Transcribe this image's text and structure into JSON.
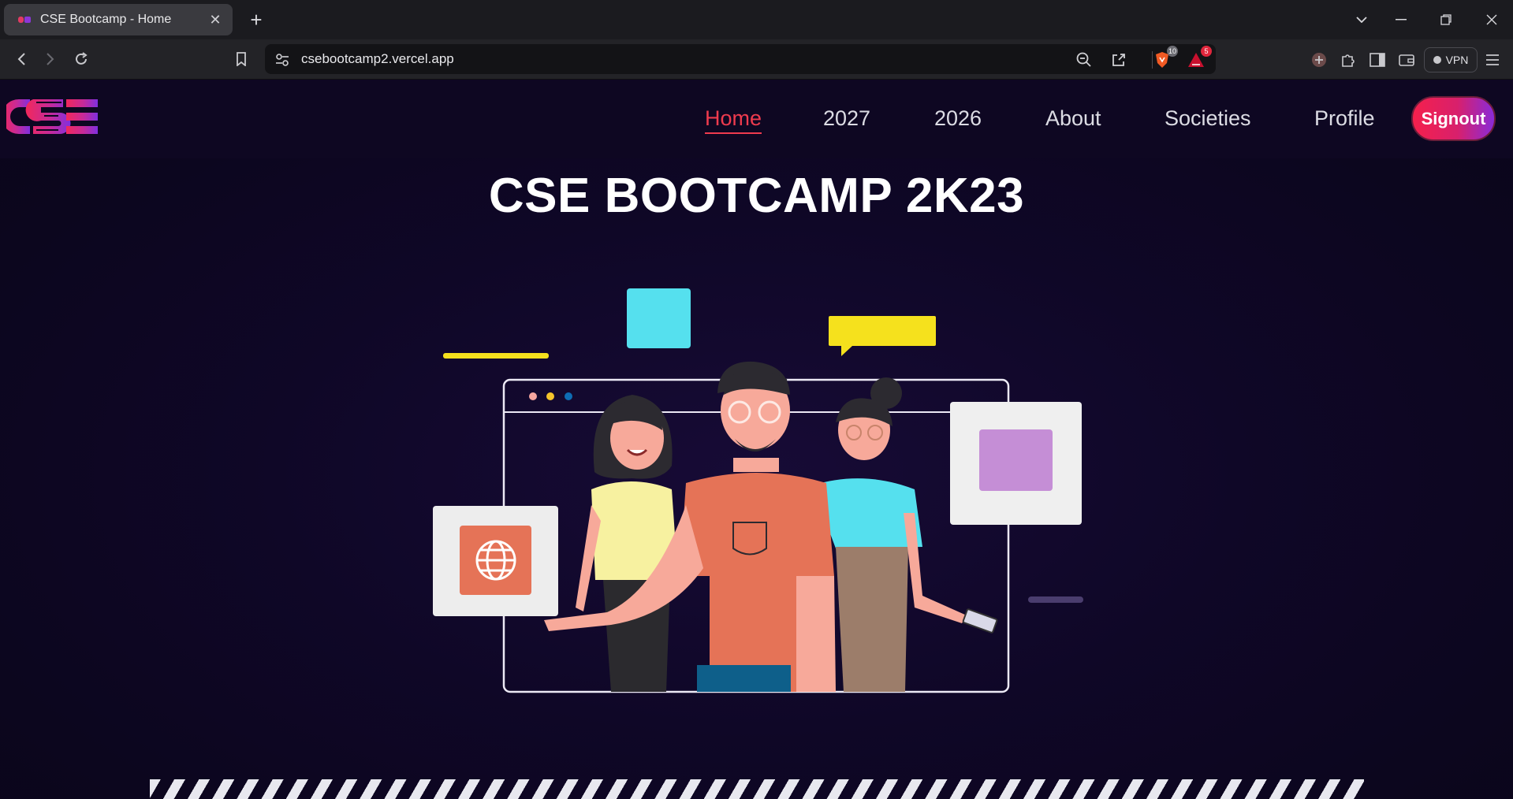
{
  "browser": {
    "tab": {
      "title": "CSE Bootcamp - Home"
    },
    "url": "csebootcamp2.vercel.app",
    "shield_badge": "10",
    "alert_badge": "5",
    "vpn_label": "VPN"
  },
  "site": {
    "logo_text": "CSE",
    "nav": [
      {
        "label": "Home"
      },
      {
        "label": "2027"
      },
      {
        "label": "2026"
      },
      {
        "label": "About"
      },
      {
        "label": "Societies"
      },
      {
        "label": "Profile"
      }
    ],
    "signout_label": "Signout",
    "hero_title": "CSE BOOTCAMP 2K23"
  },
  "colors": {
    "accent": "#ef3b4e",
    "background": "#0d061d",
    "signout_gradient_start": "#f5204c",
    "signout_gradient_end": "#8a2bd8"
  },
  "icons": {
    "tab_close": "close-icon",
    "new_tab": "plus-icon",
    "back": "arrow-left-icon",
    "forward": "arrow-right-icon",
    "reload": "reload-icon",
    "bookmark": "bookmark-icon",
    "site_settings": "tune-icon",
    "zoom": "zoom-out-icon",
    "share": "share-icon",
    "brave_shield": "shield-icon",
    "rewards": "triangle-alert-icon",
    "extensions": "puzzle-icon",
    "sidebar": "sidebar-icon",
    "wallet": "wallet-icon",
    "menu": "hamburger-icon",
    "globe": "globe-icon"
  }
}
